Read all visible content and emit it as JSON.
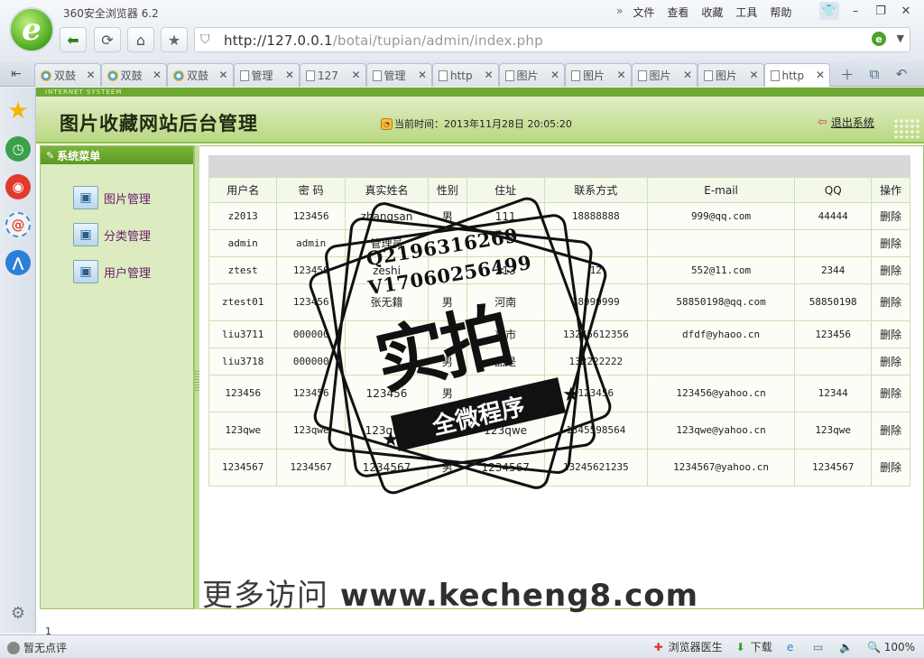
{
  "browser": {
    "title": "360安全浏览器 6.2",
    "menu": [
      "文件",
      "查看",
      "收藏",
      "工具",
      "帮助"
    ],
    "menu_more": "»",
    "address": {
      "host": "http://127.0.0.1",
      "path": "/botai/tupian/admin/index.php"
    },
    "tabs": [
      {
        "label": "双鼓",
        "icon": "web"
      },
      {
        "label": "双鼓",
        "icon": "web"
      },
      {
        "label": "双鼓",
        "icon": "web"
      },
      {
        "label": "管理",
        "icon": "page"
      },
      {
        "label": "127",
        "icon": "page"
      },
      {
        "label": "管理",
        "icon": "page"
      },
      {
        "label": "http",
        "icon": "page"
      },
      {
        "label": "图片",
        "icon": "page"
      },
      {
        "label": "图片",
        "icon": "page"
      },
      {
        "label": "图片",
        "icon": "page"
      },
      {
        "label": "图片",
        "icon": "page"
      },
      {
        "label": "http",
        "icon": "page",
        "active": true
      }
    ],
    "status": {
      "rating": "暂无点评",
      "doctor": "浏览器医生",
      "download": "下载",
      "zoom": "100%"
    }
  },
  "page": {
    "tagline": "INTERNET SYSTEEM",
    "title": "图片收藏网站后台管理",
    "time_label": "当前时间：",
    "time_value": "2013年11月28日 20:05:20",
    "logout": "退出系统",
    "menu_title": "系统菜单",
    "menu_items": [
      "图片管理",
      "分类管理",
      "用户管理"
    ],
    "table": {
      "headers": [
        "用户名",
        "密 码",
        "真实姓名",
        "性别",
        "住址",
        "联系方式",
        "E-mail",
        "QQ",
        "操作"
      ],
      "rows": [
        [
          "z2013",
          "123456",
          "zhangsan",
          "男",
          "111",
          "18888888",
          "999@qq.com",
          "44444",
          "删除"
        ],
        [
          "admin",
          "admin",
          "管理员",
          "",
          "",
          "",
          "",
          "",
          "删除"
        ],
        [
          "ztest",
          "123456",
          "zeshi",
          "",
          "213",
          "12",
          "552@11.com",
          "2344",
          "删除"
        ],
        [
          "ztest01",
          "123456",
          "张无籍",
          "男",
          "河南",
          "18999999",
          "58850198@qq.com",
          "58850198",
          "删除"
        ],
        [
          "liu3711",
          "000000",
          "",
          "",
          "京市",
          "13245612356",
          "dfdf@yhaoo.cn",
          "123456",
          "删除"
        ],
        [
          "liu3718",
          "000000",
          "",
          "男",
          "品是",
          "132222222",
          "",
          "",
          "删除"
        ],
        [
          "123456",
          "123456",
          "123456",
          "男",
          "",
          "123456",
          "123456@yahoo.cn",
          "12344",
          "删除"
        ],
        [
          "123qwe",
          "123qwe",
          "123qwe",
          "男",
          "123qwe",
          "1345598564",
          "123qwe@yahoo.cn",
          "123qwe",
          "删除"
        ],
        [
          "1234567",
          "1234567",
          "1234567",
          "男",
          "1234567",
          "13245621235",
          "1234567@yahoo.cn",
          "1234567",
          "删除"
        ]
      ]
    },
    "page_number": "1"
  },
  "watermark": {
    "qq": "Q2196316269",
    "vx": "V17060256499",
    "big": "实拍",
    "ribbon": "全微程序",
    "site_cn": "更多访问",
    "site_url": "www.kecheng8.com"
  }
}
